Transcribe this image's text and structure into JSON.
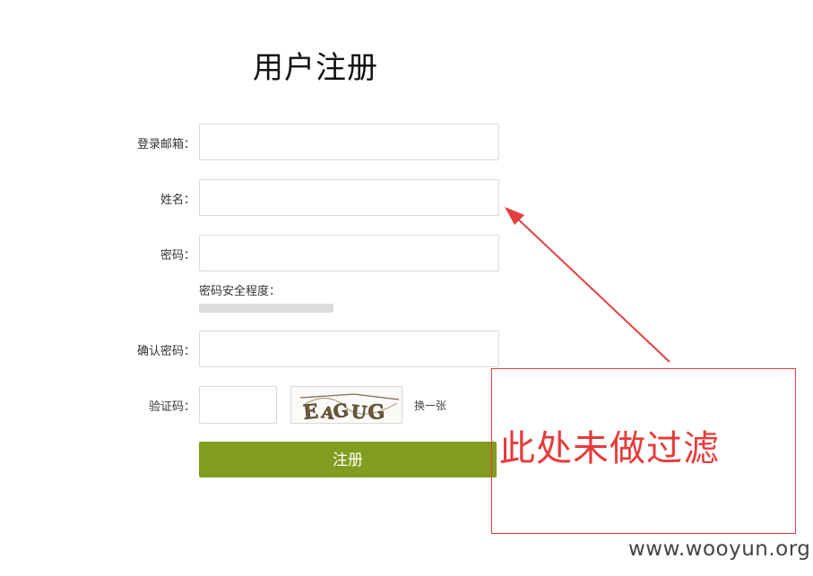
{
  "page": {
    "title": "用户注册"
  },
  "form": {
    "email_label": "登录邮箱：",
    "name_label": "姓名：",
    "password_label": "密码：",
    "strength_label": "密码安全程度：",
    "confirm_label": "确认密码：",
    "captcha_label": "验证码：",
    "captcha_text": "EAGUG",
    "refresh_label": "换一张",
    "submit_label": "注册",
    "password_strength": 0
  },
  "annotation": {
    "text": "此处未做过滤",
    "color": "#e83a3a"
  },
  "watermark": {
    "text": "www.wooyun.org"
  },
  "colors": {
    "submit_bg": "#839b1e",
    "annotation": "#e34040"
  }
}
